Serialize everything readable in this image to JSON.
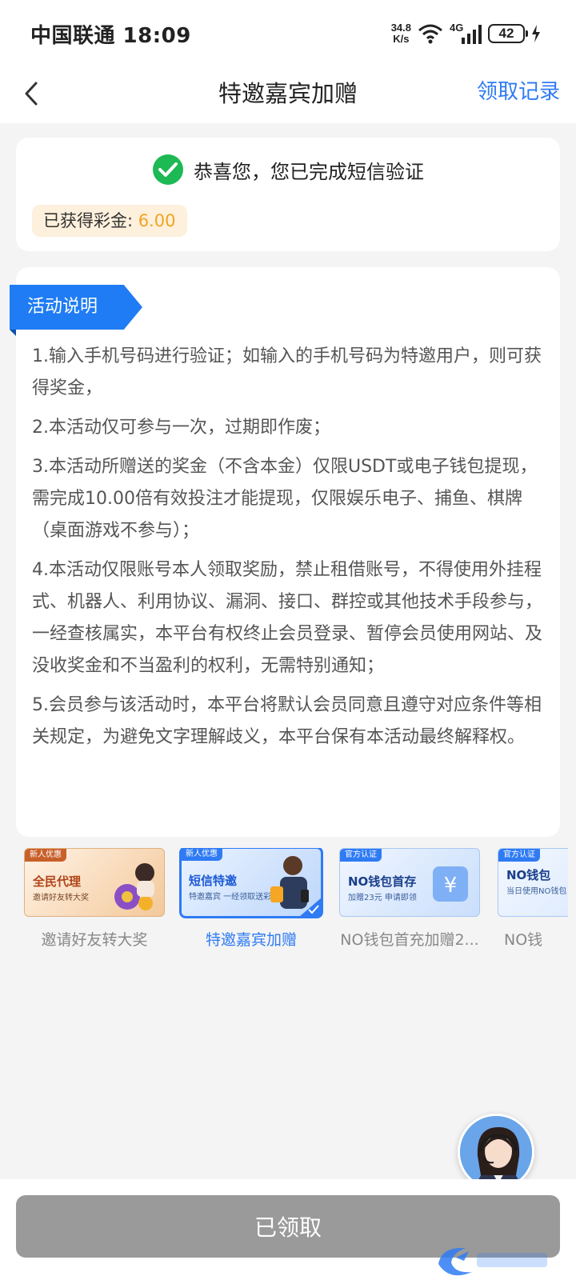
{
  "status_bar": {
    "carrier_time": "中国联通 18:09",
    "net_speed_value": "34.8",
    "net_speed_unit": "K/s",
    "network": "4G",
    "battery": "42"
  },
  "nav": {
    "title": "特邀嘉宾加赠",
    "action": "领取记录"
  },
  "verify": {
    "message": "恭喜您，您已完成短信验证",
    "bonus_label": "已获得彩金: ",
    "bonus_value": "6.00"
  },
  "rules": {
    "tag": "活动说明",
    "items": [
      "1.输入手机号码进行验证；如输入的手机号码为特邀用户，则可获得奖金，",
      "2.本活动仅可参与一次，过期即作废；",
      "3.本活动所赠送的奖金（不含本金）仅限USDT或电子钱包提现，需完成10.00倍有效投注才能提现，仅限娱乐电子、捕鱼、棋牌（桌面游戏不参与）；",
      "4.本活动仅限账号本人领取奖励，禁止租借账号，不得使用外挂程式、机器人、利用协议、漏洞、接口、群控或其他技术手段参与，一经查核属实，本平台有权终止会员登录、暂停会员使用网站、及没收奖金和不当盈利的权利，无需特别通知；",
      "5.会员参与该活动时，本平台将默认会员同意且遵守对应条件等相关规定，为避免文字理解歧义，本平台保有本活动最终解释权。"
    ]
  },
  "promos": [
    {
      "label": "邀请好友转大奖",
      "badge": "新人优惠",
      "headline": "全民代理",
      "sub": "邀请好友转大奖",
      "active": false
    },
    {
      "label": "特邀嘉宾加赠",
      "badge": "新人优惠",
      "headline": "短信特邀",
      "sub": "特邀嘉宾 一经领取送彩金",
      "active": true
    },
    {
      "label": "NO钱包首充加赠2...",
      "badge": "官方认证",
      "headline": "NO钱包首存",
      "sub": "加赠23元 申请即领",
      "active": false
    },
    {
      "label": "NO钱",
      "badge": "官方认证",
      "headline": "NO钱包",
      "sub": "当日使用NO钱包",
      "active": false
    }
  ],
  "bottom": {
    "button": "已领取"
  },
  "colors": {
    "accent": "#2f7bf4",
    "success": "#1db954",
    "bonus": "#f2a320",
    "disabled": "#9a9a9a"
  }
}
